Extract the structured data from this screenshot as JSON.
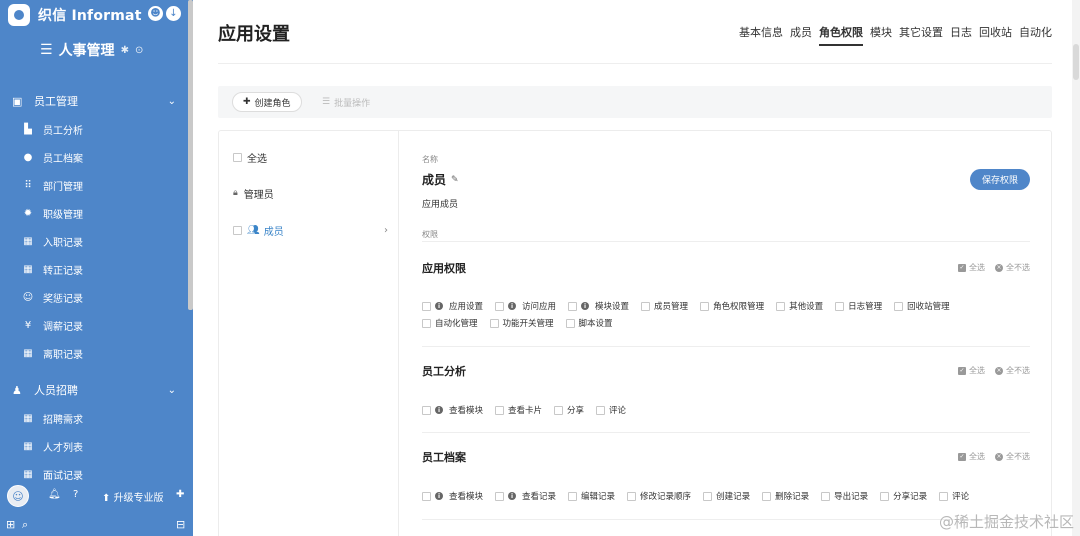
{
  "sidebar": {
    "brand": "织信 Informat",
    "app_name": "人事管理",
    "groups": [
      {
        "label": "员工管理",
        "items": [
          {
            "icon": "chart-icon",
            "glyph": "📊",
            "label": "员工分析"
          },
          {
            "icon": "user-icon",
            "glyph": "●",
            "label": "员工档案"
          },
          {
            "icon": "org-icon",
            "glyph": "⠿",
            "label": "部门管理"
          },
          {
            "icon": "gear-icon",
            "glyph": "✹",
            "label": "职级管理"
          },
          {
            "icon": "table-icon",
            "glyph": "▦",
            "label": "入职记录"
          },
          {
            "icon": "table-icon",
            "glyph": "▦",
            "label": "转正记录"
          },
          {
            "icon": "smile-icon",
            "glyph": "☺",
            "label": "奖惩记录"
          },
          {
            "icon": "yen-icon",
            "glyph": "¥",
            "label": "调薪记录"
          },
          {
            "icon": "table-icon",
            "glyph": "▦",
            "label": "离职记录"
          }
        ]
      },
      {
        "label": "人员招聘",
        "items": [
          {
            "icon": "table-icon",
            "glyph": "▦",
            "label": "招聘需求"
          },
          {
            "icon": "table-icon",
            "glyph": "▦",
            "label": "人才列表"
          },
          {
            "icon": "table-icon",
            "glyph": "▦",
            "label": "面试记录"
          }
        ]
      }
    ],
    "upgrade": "升级专业版"
  },
  "header": {
    "title": "应用设置",
    "tabs": [
      "基本信息",
      "成员",
      "角色权限",
      "模块",
      "其它设置",
      "日志",
      "回收站",
      "自动化"
    ],
    "active_tab": "角色权限"
  },
  "toolbar": {
    "create_role": "创建角色",
    "batch_ops": "批量操作"
  },
  "roles": {
    "select_all": "全选",
    "items": [
      "管理员",
      "成员"
    ],
    "active": "成员"
  },
  "detail": {
    "name_label": "名称",
    "role_name": "成员",
    "role_desc": "应用成员",
    "save": "保存权限",
    "perm_label": "权限",
    "select_all": "全选",
    "select_none": "全不选",
    "sections": [
      {
        "title": "应用权限",
        "rows": [
          [
            {
              "label": "应用设置",
              "info": true
            },
            {
              "label": "访问应用",
              "info": true
            },
            {
              "label": "模块设置",
              "info": true
            },
            {
              "label": "成员管理"
            },
            {
              "label": "角色权限管理"
            },
            {
              "label": "其他设置"
            },
            {
              "label": "日志管理"
            },
            {
              "label": "回收站管理"
            }
          ],
          [
            {
              "label": "自动化管理"
            },
            {
              "label": "功能开关管理"
            },
            {
              "label": "脚本设置"
            }
          ]
        ]
      },
      {
        "title": "员工分析",
        "rows": [
          [
            {
              "label": "查看模块",
              "info": true
            },
            {
              "label": "查看卡片"
            },
            {
              "label": "分享"
            },
            {
              "label": "评论"
            }
          ]
        ]
      },
      {
        "title": "员工档案",
        "rows": [
          [
            {
              "label": "查看模块",
              "info": true
            },
            {
              "label": "查看记录",
              "info": true
            },
            {
              "label": "编辑记录"
            },
            {
              "label": "修改记录顺序"
            },
            {
              "label": "创建记录"
            },
            {
              "label": "删除记录"
            },
            {
              "label": "导出记录"
            },
            {
              "label": "分享记录"
            },
            {
              "label": "评论"
            }
          ]
        ]
      }
    ]
  },
  "watermark": "@稀土掘金技术社区",
  "colors": {
    "sidebar_bg": "#4e86c9",
    "accent": "#3b85c8",
    "save_btn": "#4f86c9"
  }
}
